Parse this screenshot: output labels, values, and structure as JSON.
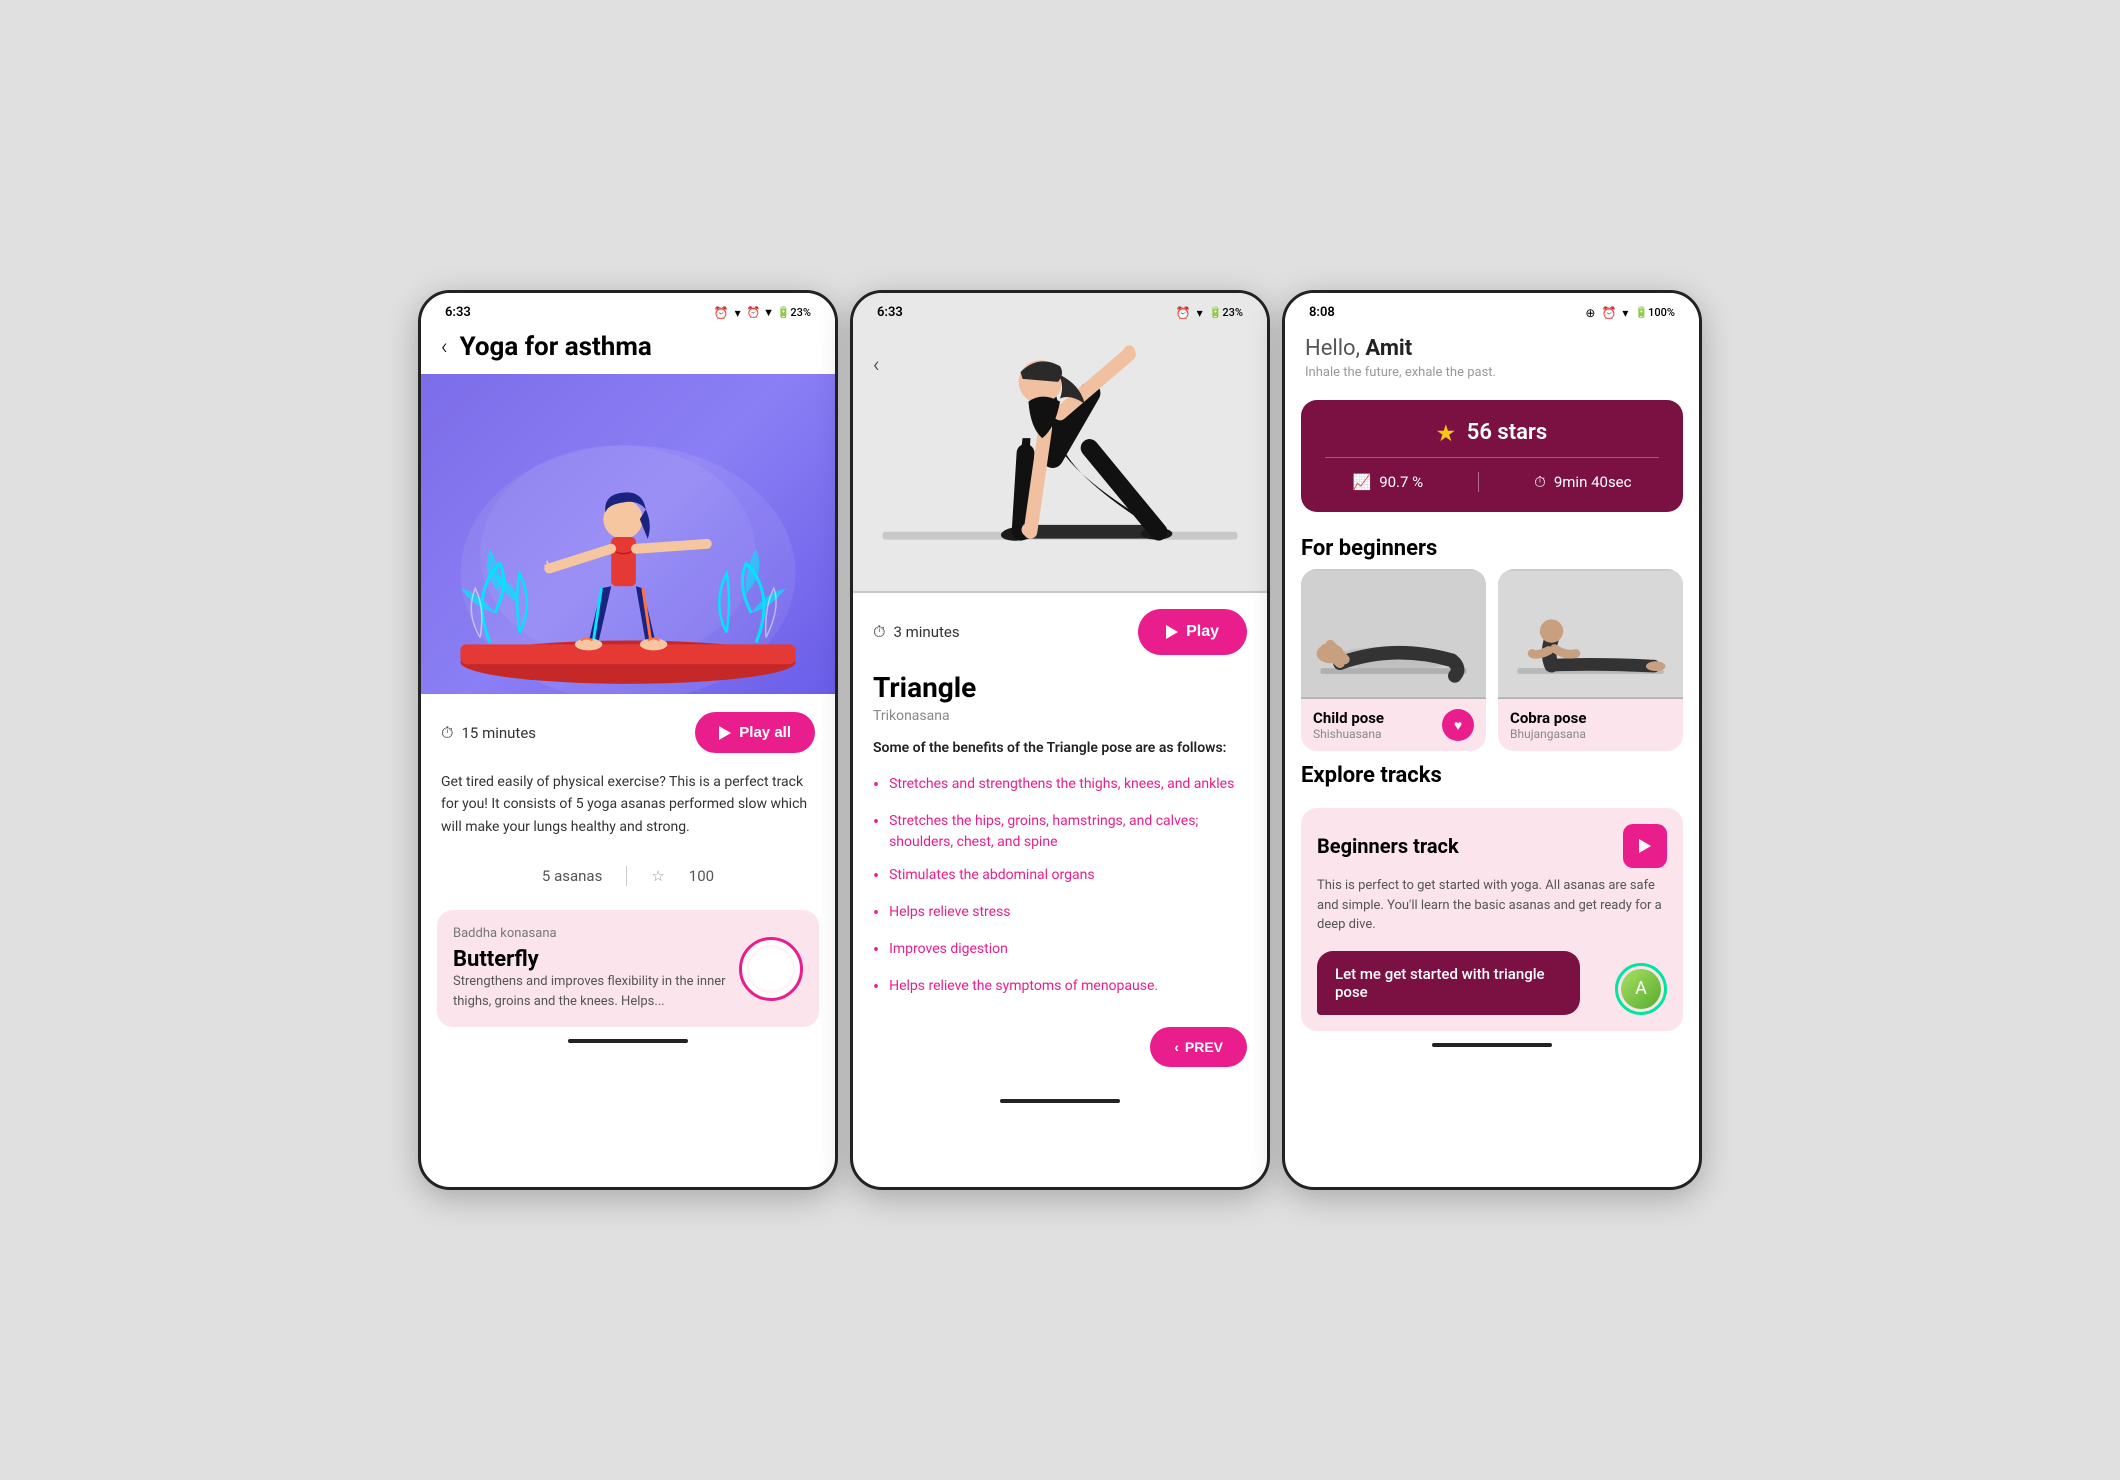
{
  "screen1": {
    "status_time": "6:33",
    "status_icons": "⏰ ▼ 🔋23%",
    "title": "Yoga for asthma",
    "timer": "15 minutes",
    "play_all_btn": "Play all",
    "description": "Get tired easily of physical exercise? This is a perfect track for you! It consists of 5 yoga asanas performed slow which will make your lungs healthy and strong.",
    "asanas_count": "5 asanas",
    "stars": "100",
    "asana_name": "Butterfly",
    "asana_sanskrit": "Baddha konasana",
    "asana_desc": "Strengthens and improves flexibility in the inner thighs, groins and the knees. Helps..."
  },
  "screen2": {
    "status_time": "6:33",
    "status_icons": "⏰ ▼ 🔋23%",
    "timer": "3 minutes",
    "play_btn": "Play",
    "pose_title": "Triangle",
    "pose_sanskrit": "Trikonasana",
    "benefits_intro": "Some of the benefits of the Triangle pose are as follows:",
    "benefits": [
      "Stretches and strengthens the thighs, knees, and ankles",
      "Stretches the hips, groins, hamstrings, and calves; shoulders, chest, and spine",
      "Stimulates the abdominal organs",
      "Helps relieve stress",
      "Improves digestion",
      "Helps relieve the symptoms of menopause."
    ],
    "prev_btn": "PREV"
  },
  "screen3": {
    "status_time": "8:08",
    "status_icons": "⊕ ⏰ ▼ 🔋100%",
    "greeting_hello": "Hello, ",
    "greeting_name": "Amit",
    "greeting_sub": "Inhale the future, exhale the past.",
    "stars_count": "56 stars",
    "progress": "90.7 %",
    "time_spent": "9min 40sec",
    "for_beginners": "For beginners",
    "poses": [
      {
        "name": "Child pose",
        "sanskrit": "Shishuasana"
      },
      {
        "name": "Cobra pose",
        "sanskrit": "Bhujangasana"
      }
    ],
    "explore_tracks": "Explore tracks",
    "track_title": "Beginners track",
    "track_desc": "This is perfect to get started with yoga. All asanas are safe and simple. You'll learn the basic asanas and get ready for a deep dive.",
    "chat_message": "Let me get started with triangle pose"
  }
}
